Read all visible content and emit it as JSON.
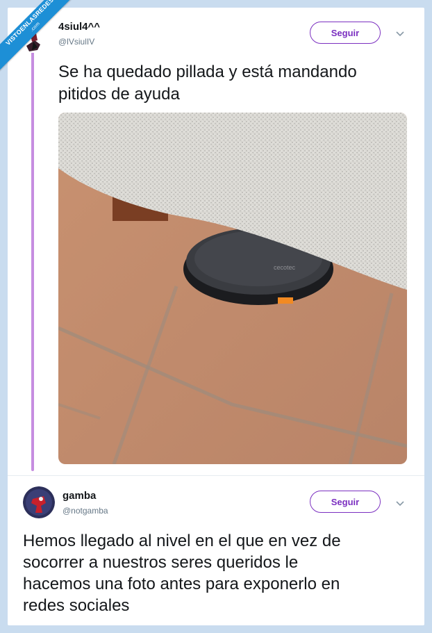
{
  "watermark": {
    "text": "VISTOENLASREDES",
    "sub": ".com"
  },
  "tweet1": {
    "name": "4siul4^^",
    "handle": "@lVsiulIV",
    "follow_label": "Seguir",
    "text_line1": "Se ha quedado pillada y está mandando",
    "text_line2": "pitidos de ayuda",
    "photo_brand_text": "cecotec"
  },
  "tweet2": {
    "name": "gamba",
    "handle": "@notgamba",
    "follow_label": "Seguir",
    "text_line1": "Hemos llegado al nivel en el que en vez de",
    "text_line2": "socorrer a nuestros seres queridos le",
    "text_line3": "hacemos una foto antes para exponerlo en",
    "text_line4": "redes sociales"
  },
  "colors": {
    "accent": "#7b2fc0",
    "thread_line": "#c68de0",
    "ribbon": "#1d8fd6",
    "text": "#14171a",
    "secondary_text": "#657786"
  },
  "icons": [
    "chevron-down-icon",
    "avatar-image"
  ]
}
